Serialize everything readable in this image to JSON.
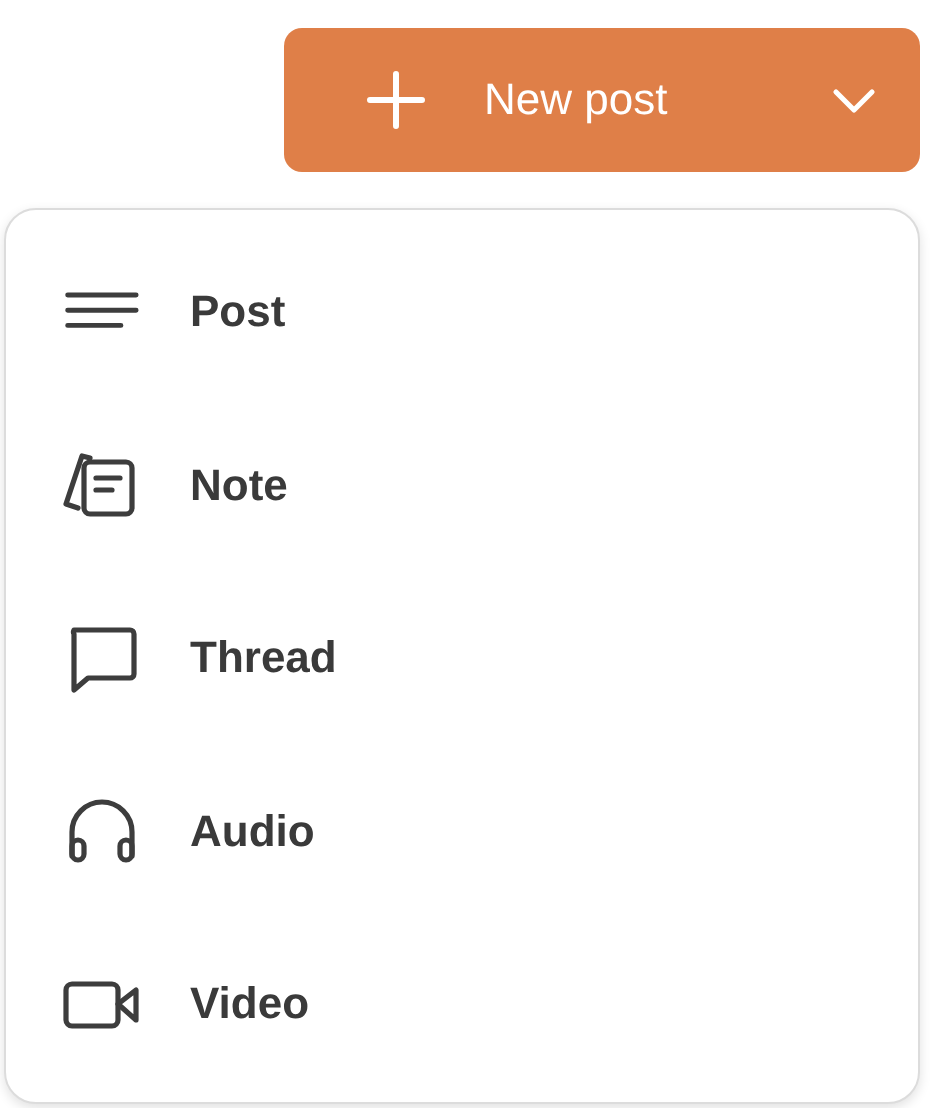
{
  "new_post_button": {
    "label": "New post"
  },
  "menu": {
    "items": [
      {
        "kind": "post",
        "label": "Post"
      },
      {
        "kind": "note",
        "label": "Note"
      },
      {
        "kind": "thread",
        "label": "Thread"
      },
      {
        "kind": "audio",
        "label": "Audio"
      },
      {
        "kind": "video",
        "label": "Video"
      }
    ]
  }
}
